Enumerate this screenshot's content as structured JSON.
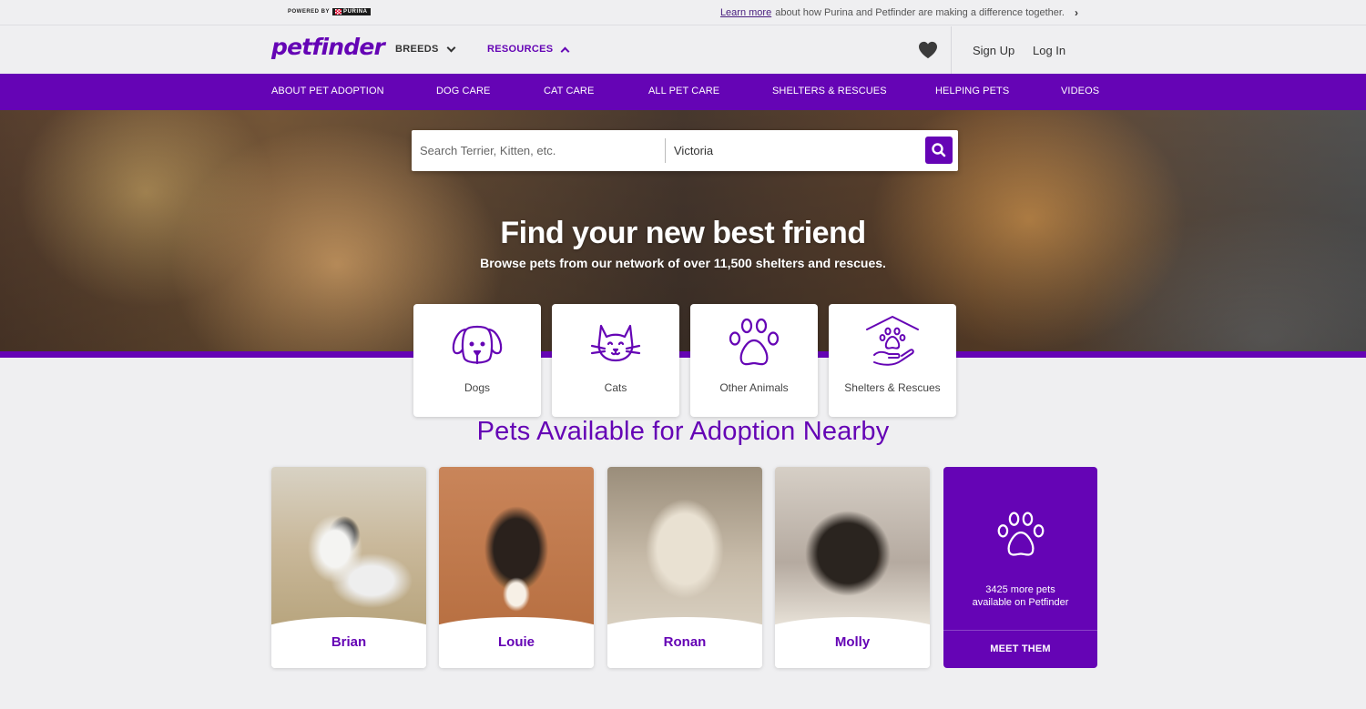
{
  "topbar": {
    "powered_by": "POWERED BY",
    "purina_brand": "PURINA",
    "learn_link": "Learn more",
    "learn_text": "about how Purina and Petfinder are making a difference together."
  },
  "header": {
    "logo": "petfinder",
    "breeds": "BREEDS",
    "resources": "RESOURCES",
    "signup": "Sign Up",
    "login": "Log In"
  },
  "nav": {
    "items": [
      "ABOUT PET ADOPTION",
      "DOG CARE",
      "CAT CARE",
      "ALL PET CARE",
      "SHELTERS & RESCUES",
      "HELPING PETS",
      "VIDEOS"
    ]
  },
  "search": {
    "query_placeholder": "Search Terrier, Kitten, etc.",
    "location_value": "Victoria"
  },
  "hero": {
    "title": "Find your new best friend",
    "subtitle": "Browse pets from our network of over 11,500 shelters and rescues."
  },
  "categories": [
    {
      "label": "Dogs",
      "icon": "dog-icon"
    },
    {
      "label": "Cats",
      "icon": "cat-icon"
    },
    {
      "label": "Other Animals",
      "icon": "paw-icon"
    },
    {
      "label": "Shelters & Rescues",
      "icon": "shelter-icon"
    }
  ],
  "pets_section": {
    "title": "Pets Available for Adoption Nearby",
    "pets": [
      {
        "name": "Brian"
      },
      {
        "name": "Louie"
      },
      {
        "name": "Ronan"
      },
      {
        "name": "Molly"
      }
    ],
    "more": {
      "text": "3425 more pets available on Petfinder",
      "cta": "MEET THEM"
    }
  },
  "colors": {
    "brand_purple": "#6504b5",
    "background": "#efeff1"
  }
}
